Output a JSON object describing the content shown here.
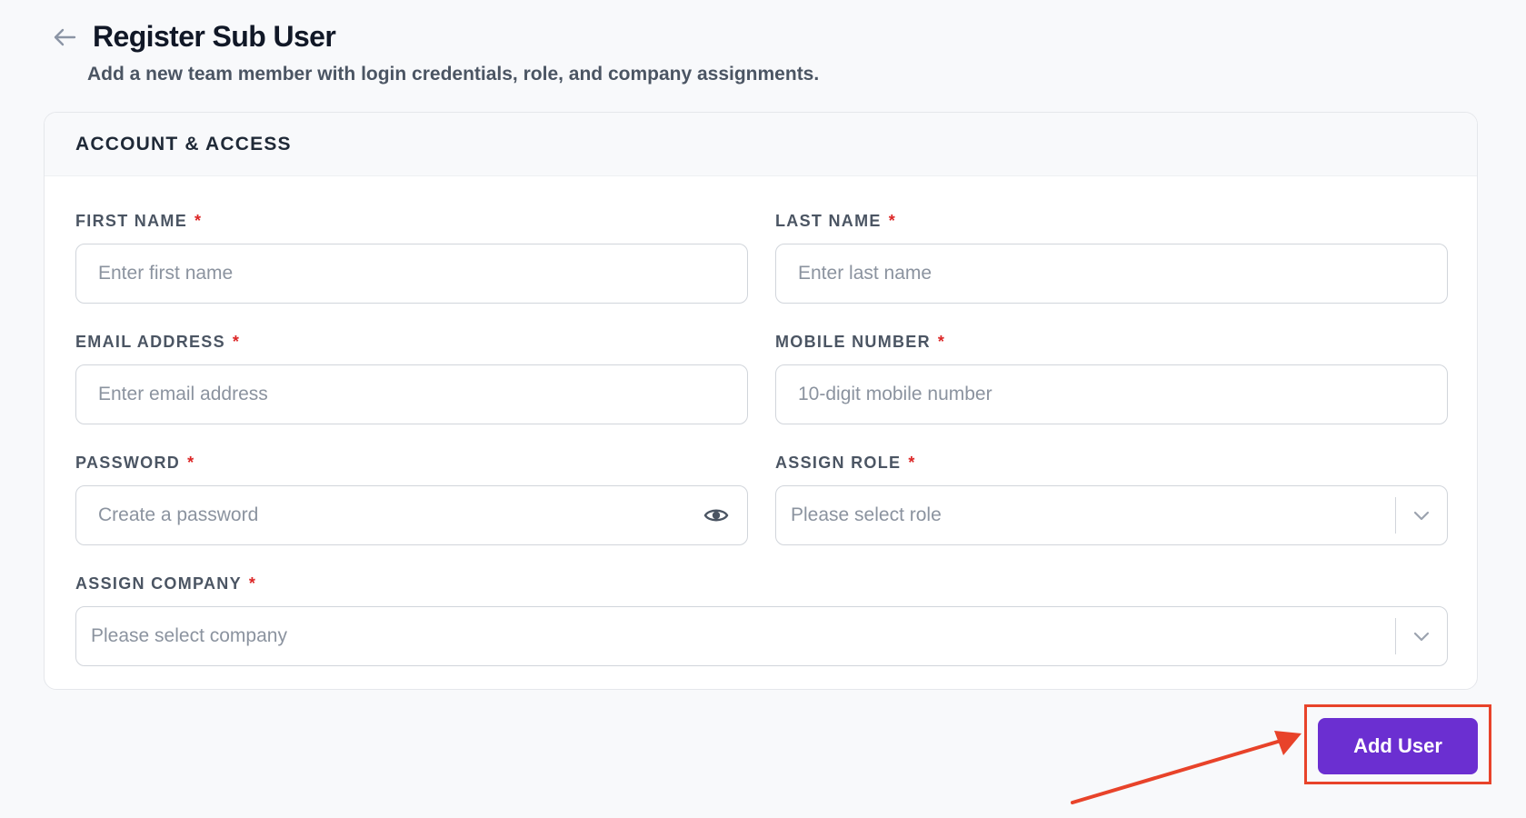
{
  "header": {
    "back_icon": "arrow-left-icon",
    "title": "Register Sub User",
    "subtitle": "Add a new team member with login credentials, role, and company assignments."
  },
  "card": {
    "title": "ACCOUNT & ACCESS",
    "fields": {
      "first_name": {
        "label": "FIRST NAME",
        "required": "*",
        "placeholder": "Enter first name",
        "value": ""
      },
      "last_name": {
        "label": "LAST NAME",
        "required": "*",
        "placeholder": "Enter last name",
        "value": ""
      },
      "email": {
        "label": "EMAIL ADDRESS",
        "required": "*",
        "placeholder": "Enter email address",
        "value": ""
      },
      "mobile": {
        "label": "MOBILE NUMBER",
        "required": "*",
        "placeholder": "10-digit mobile number",
        "value": ""
      },
      "password": {
        "label": "PASSWORD",
        "required": "*",
        "placeholder": "Create a password",
        "value": "",
        "toggle_icon": "eye-icon"
      },
      "role": {
        "label": "ASSIGN ROLE",
        "required": "*",
        "selected": "Please select role",
        "chevron_icon": "chevron-down-icon"
      },
      "company": {
        "label": "ASSIGN COMPANY",
        "required": "*",
        "selected": "Please select company",
        "chevron_icon": "chevron-down-icon"
      }
    }
  },
  "actions": {
    "add_user_label": "Add User"
  },
  "colors": {
    "accent": "#6b2fd1",
    "required": "#dc2626",
    "annotation": "#e8432a",
    "background": "#f8f9fb"
  }
}
